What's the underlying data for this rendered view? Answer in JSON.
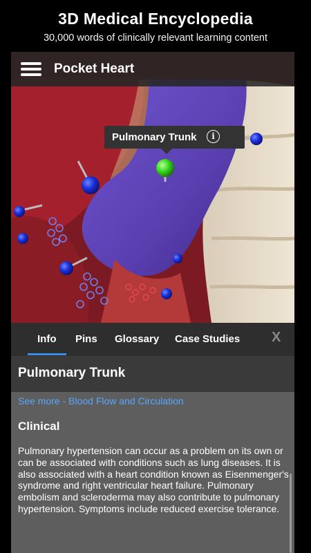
{
  "promo": {
    "title": "3D Medical Encyclopedia",
    "subtitle": "30,000 words of clinically relevant learning content"
  },
  "app_bar": {
    "menu_icon": "hamburger-menu-icon",
    "title": "Pocket Heart"
  },
  "viewer": {
    "selected_pin_label": "Pulmonary Trunk",
    "tooltip_icon": "info-icon",
    "colors": {
      "selected_pin": "#39d81e",
      "pin": "#1b2fd8",
      "pulmonary_trunk": "#6a50c0",
      "heart_muscle": "#9a1f2a"
    }
  },
  "tabs": {
    "items": [
      {
        "label": "Info",
        "active": true
      },
      {
        "label": "Pins",
        "active": false
      },
      {
        "label": "Glossary",
        "active": false
      },
      {
        "label": "Case Studies",
        "active": false
      }
    ],
    "close_label": "X",
    "accent_color": "#3b8ee6"
  },
  "info": {
    "title": "Pulmonary Trunk",
    "see_more_link": "See more - Blood Flow and Circulation",
    "section_heading": "Clinical",
    "body": "Pulmonary hypertension can occur as a problem on its own or can be associated with conditions such as lung diseases. It is also associated with a heart condition known as Eisenmenger's syndrome and right ventricular heart failure. Pulmonary embolism and scleroderma may also contribute to pulmonary hypertension. Symptoms include reduced exercise tolerance."
  }
}
